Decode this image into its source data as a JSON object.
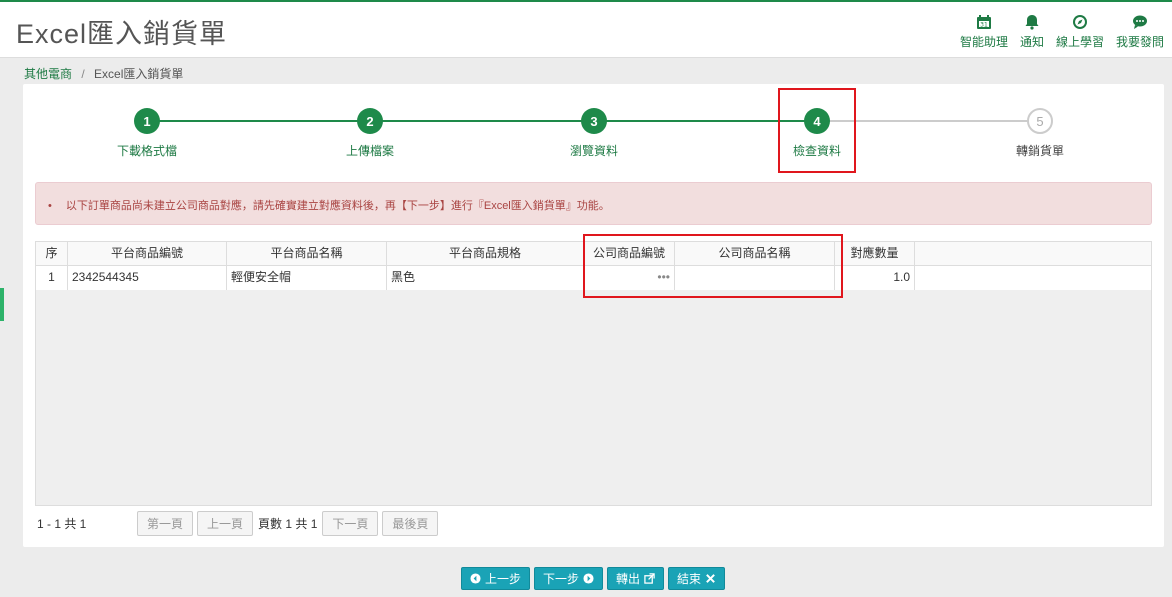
{
  "header": {
    "title": "Excel匯入銷貨單",
    "tools": [
      {
        "label": "智能助理",
        "icon": "calendar-icon"
      },
      {
        "label": "通知",
        "icon": "bell-icon"
      },
      {
        "label": "線上學習",
        "icon": "compass-icon"
      },
      {
        "label": "我要發問",
        "icon": "chat-icon"
      }
    ]
  },
  "breadcrumb": {
    "parent": "其他電商",
    "separator": "/",
    "current": "Excel匯入銷貨單"
  },
  "steps": [
    {
      "num": "1",
      "label": "下載格式檔",
      "state": "done"
    },
    {
      "num": "2",
      "label": "上傳檔案",
      "state": "done"
    },
    {
      "num": "3",
      "label": "瀏覽資料",
      "state": "done"
    },
    {
      "num": "4",
      "label": "檢查資料",
      "state": "current"
    },
    {
      "num": "5",
      "label": "轉銷貨單",
      "state": "todo"
    }
  ],
  "alert": {
    "bullet": "•",
    "text": "以下訂單商品尚未建立公司商品對應，請先確實建立對應資料後，再【下一步】進行『Excel匯入銷貨單』功能。"
  },
  "grid": {
    "columns": [
      "序",
      "平台商品編號",
      "平台商品名稱",
      "平台商品規格",
      "公司商品編號",
      "公司商品名稱",
      "對應數量"
    ],
    "rows": [
      {
        "seq": "1",
        "platform_code": "2342544345",
        "platform_name": "輕便安全帽",
        "platform_spec": "黑色",
        "company_code": "•••",
        "company_name": "",
        "qty": "1.0"
      }
    ]
  },
  "pager": {
    "info": "1 - 1 共 1",
    "first": "第一頁",
    "prev": "上一頁",
    "pages": "頁數 1 共 1",
    "next": "下一頁",
    "last": "最後頁"
  },
  "actions": {
    "prev": "上一步",
    "next": "下一步",
    "export": "轉出",
    "finish": "結束"
  },
  "colors": {
    "primary_green": "#1e8a4a",
    "alert_bg": "#f2dede",
    "alert_text": "#a94442",
    "highlight_red": "#e0161d",
    "button_teal": "#1aa3b6"
  }
}
